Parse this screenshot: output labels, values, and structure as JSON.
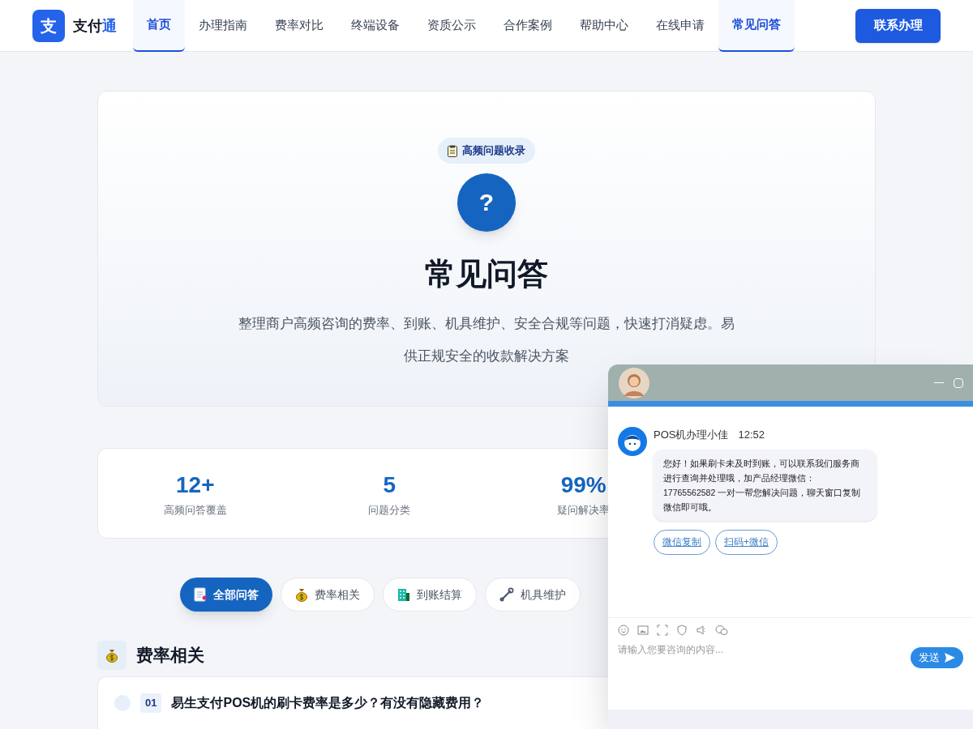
{
  "logo": {
    "mark": "支",
    "name": "支付",
    "name_accent": "通"
  },
  "nav": [
    {
      "label": "首页",
      "selected": true
    },
    {
      "label": "办理指南",
      "selected": false
    },
    {
      "label": "费率对比",
      "selected": false
    },
    {
      "label": "终端设备",
      "selected": false
    },
    {
      "label": "资质公示",
      "selected": false
    },
    {
      "label": "合作案例",
      "selected": false
    },
    {
      "label": "帮助中心",
      "selected": false
    },
    {
      "label": "在线申请",
      "selected": false
    },
    {
      "label": "常见问答",
      "selected": true
    }
  ],
  "cta": "联系办理",
  "hero": {
    "badge": "高频问题收录",
    "icon": "?",
    "title": "常见问答",
    "description": [
      "整理商户高频咨询的费率、到账、机具维护、安全合规等问题，快速打消疑虑。易",
      "供正规安全的收款解决方案"
    ]
  },
  "stats": [
    {
      "value": "12+",
      "label": "高频问答覆盖"
    },
    {
      "value": "5",
      "label": "问题分类"
    },
    {
      "value": "99%",
      "label": "疑问解决率"
    }
  ],
  "filters": [
    {
      "label": "全部问答",
      "selected": true,
      "kind": "doc"
    },
    {
      "label": "费率相关",
      "selected": false,
      "kind": "money"
    },
    {
      "label": "到账结算",
      "selected": false,
      "kind": "building"
    },
    {
      "label": "机具维护",
      "selected": false,
      "kind": "wrench"
    }
  ],
  "section": {
    "title": "费率相关"
  },
  "faq": [
    {
      "number": "01",
      "question": "易生支付POS机的刷卡费率是多少？有没有隐藏费用？"
    }
  ],
  "chat": {
    "sender": "POS机办理小佳",
    "time": "12:52",
    "message": "您好！如果刷卡未及时到账，可以联系我们服务商进行查询并处理哦，加产品经理微信：17765562582 一对一帮您解决问题，聊天窗口复制微信即可哦。",
    "links": [
      "微信复制",
      "扫码+微信"
    ],
    "placeholder": "请输入您要咨询的内容...",
    "send": "发送"
  }
}
